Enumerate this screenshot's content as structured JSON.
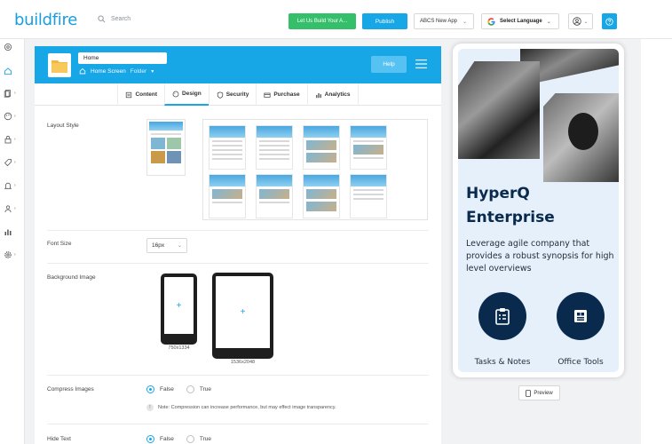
{
  "header": {
    "logo": "buildfire",
    "search_placeholder": "Search",
    "build_button": "Let Us Build Your A...",
    "publish_button": "Publish",
    "app_select": "ABCS New App",
    "language_select": "Select Language",
    "accent": "#17a6e6",
    "green": "#35bf6b"
  },
  "rail": {
    "icons": [
      "settings-icon",
      "home-icon",
      "pages-icon",
      "palette-icon",
      "lock-icon",
      "tag-icon",
      "bell-icon",
      "users-icon",
      "analytics-icon",
      "gear-icon"
    ]
  },
  "panel": {
    "title_value": "Home",
    "crumb_screen": "Home Screen",
    "crumb_type": "Folder",
    "help_button": "Help",
    "tabs": [
      "Content",
      "Design",
      "Security",
      "Purchase",
      "Analytics"
    ],
    "active_tab": "Design",
    "layout_label": "Layout Style",
    "font_size_label": "Font Size",
    "font_size_value": "16px",
    "background_label": "Background Image",
    "phone_size": "750x1334",
    "tablet_size": "1536x2048",
    "compress_label": "Compress Images",
    "compress_false": "False",
    "compress_true": "True",
    "compress_note": "Note: Compression can increase performance, but may effect image transparency.",
    "hide_text_label": "Hide Text",
    "hide_false": "False",
    "hide_true": "True"
  },
  "preview": {
    "title_line1": "HyperQ",
    "title_line2": "Enterprise",
    "description": "Leverage agile company that provides a robust synopsis for high level overviews",
    "feature1": "Tasks & Notes",
    "feature2": "Office Tools",
    "preview_button": "Preview",
    "navy": "#0a2a4d"
  }
}
